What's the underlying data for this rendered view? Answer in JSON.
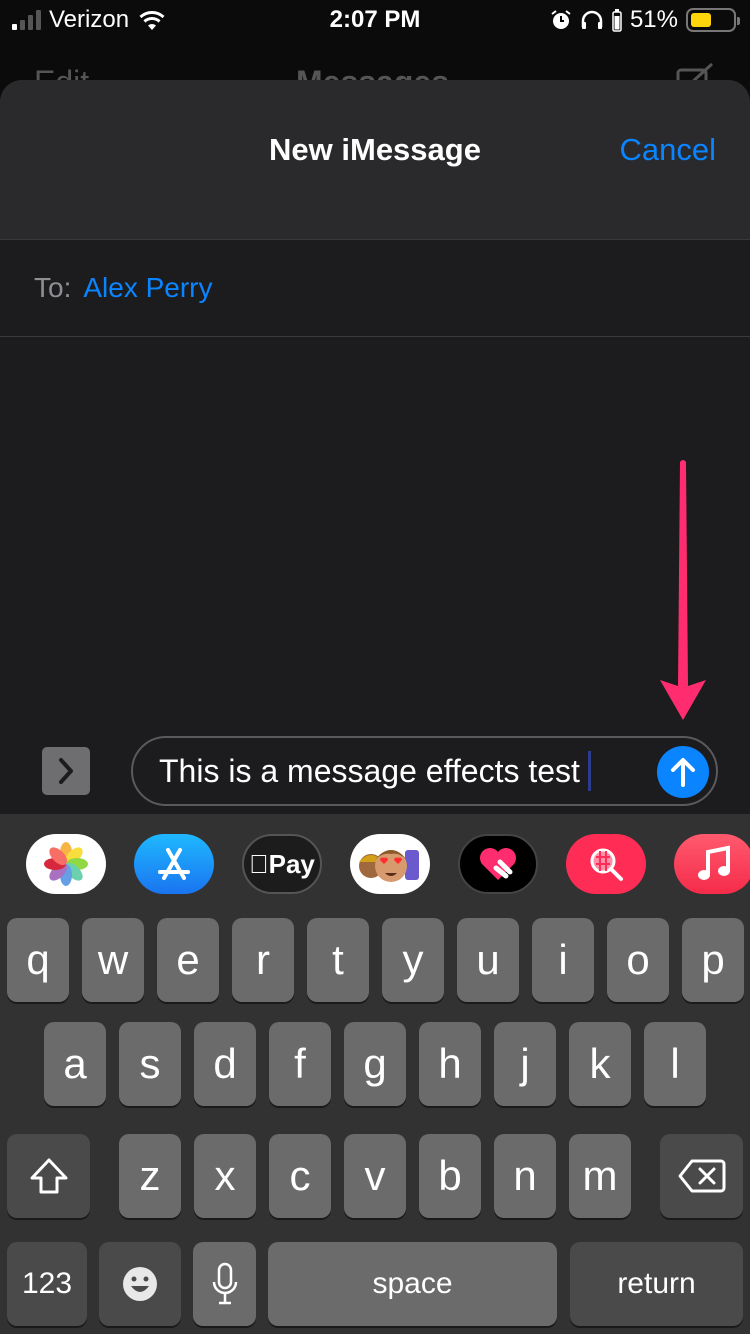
{
  "status_bar": {
    "carrier": "Verizon",
    "time": "2:07 PM",
    "battery_percent_label": "51%",
    "battery_level": 0.51,
    "signal_bars_active": 1,
    "signal_bars_total": 4,
    "icons": [
      "signal-icon",
      "wifi-icon",
      "alarm-icon",
      "headphones-icon",
      "battery-icon"
    ],
    "battery_color": "#ffd60a"
  },
  "background_screen": {
    "left_button": "Edit",
    "title": "Messages",
    "right_icon": "compose-icon"
  },
  "sheet": {
    "title": "New iMessage",
    "cancel_label": "Cancel",
    "to_label": "To:",
    "recipient": "Alex Perry"
  },
  "composer": {
    "message_text": "This is a message effects test",
    "expand_icon": "chevron-right-icon",
    "send_icon": "arrow-up-icon"
  },
  "annotation": {
    "icon": "arrow-down-icon",
    "color": "#ff2d6f"
  },
  "app_drawer": [
    {
      "name": "Photos",
      "icon": "photos-icon"
    },
    {
      "name": "App Store",
      "icon": "app-store-icon"
    },
    {
      "name": "Apple Pay",
      "icon": "apple-pay-icon",
      "label": "Pay"
    },
    {
      "name": "Memoji",
      "icon": "memoji-icon"
    },
    {
      "name": "Digital Touch",
      "icon": "digital-touch-icon"
    },
    {
      "name": "Images Search",
      "icon": "image-search-icon"
    },
    {
      "name": "Music",
      "icon": "music-icon"
    }
  ],
  "keyboard": {
    "row1": [
      "q",
      "w",
      "e",
      "r",
      "t",
      "y",
      "u",
      "i",
      "o",
      "p"
    ],
    "row2": [
      "a",
      "s",
      "d",
      "f",
      "g",
      "h",
      "j",
      "k",
      "l"
    ],
    "row3": [
      "z",
      "x",
      "c",
      "v",
      "b",
      "n",
      "m"
    ],
    "shift_icon": "shift-icon",
    "delete_icon": "delete-icon",
    "numbers_label": "123",
    "emoji_icon": "emoji-icon",
    "mic_icon": "microphone-icon",
    "space_label": "space",
    "return_label": "return"
  },
  "colors": {
    "accent": "#0a84ff",
    "sheet_bg": "#1c1c1e",
    "header_bg": "#2a2a2c",
    "keyboard_bg": "#323232",
    "key_bg": "#6b6b6b",
    "key_dark_bg": "#4a4a4a"
  }
}
